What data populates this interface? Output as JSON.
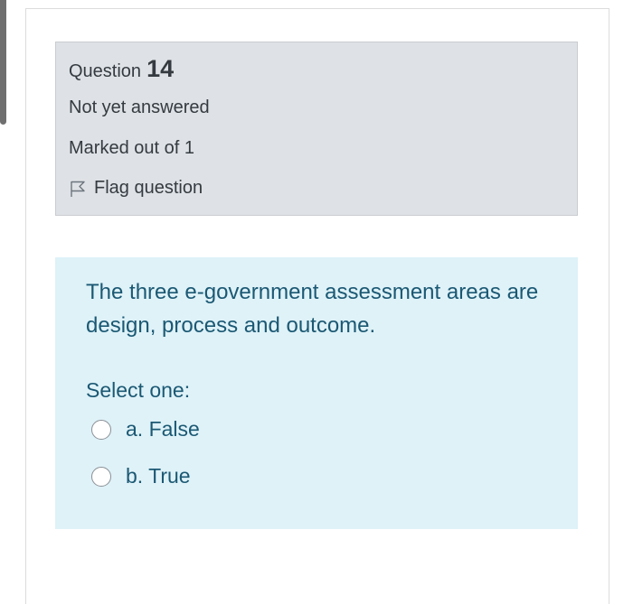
{
  "question": {
    "label": "Question",
    "number": "14",
    "state": "Not yet answered",
    "grade": "Marked out of 1",
    "flag_label": "Flag question",
    "flag_icon": "flag-outline-icon"
  },
  "content": {
    "text": "The three e-government assessment areas are design, process and outcome.",
    "prompt": "Select one:",
    "answers": [
      {
        "label": "a. False",
        "selected": false
      },
      {
        "label": "b. True",
        "selected": false
      }
    ]
  },
  "colors": {
    "info_bg": "#dee2e6",
    "content_bg": "#def2f8",
    "content_text": "#1b5873",
    "info_text": "#343a40"
  }
}
